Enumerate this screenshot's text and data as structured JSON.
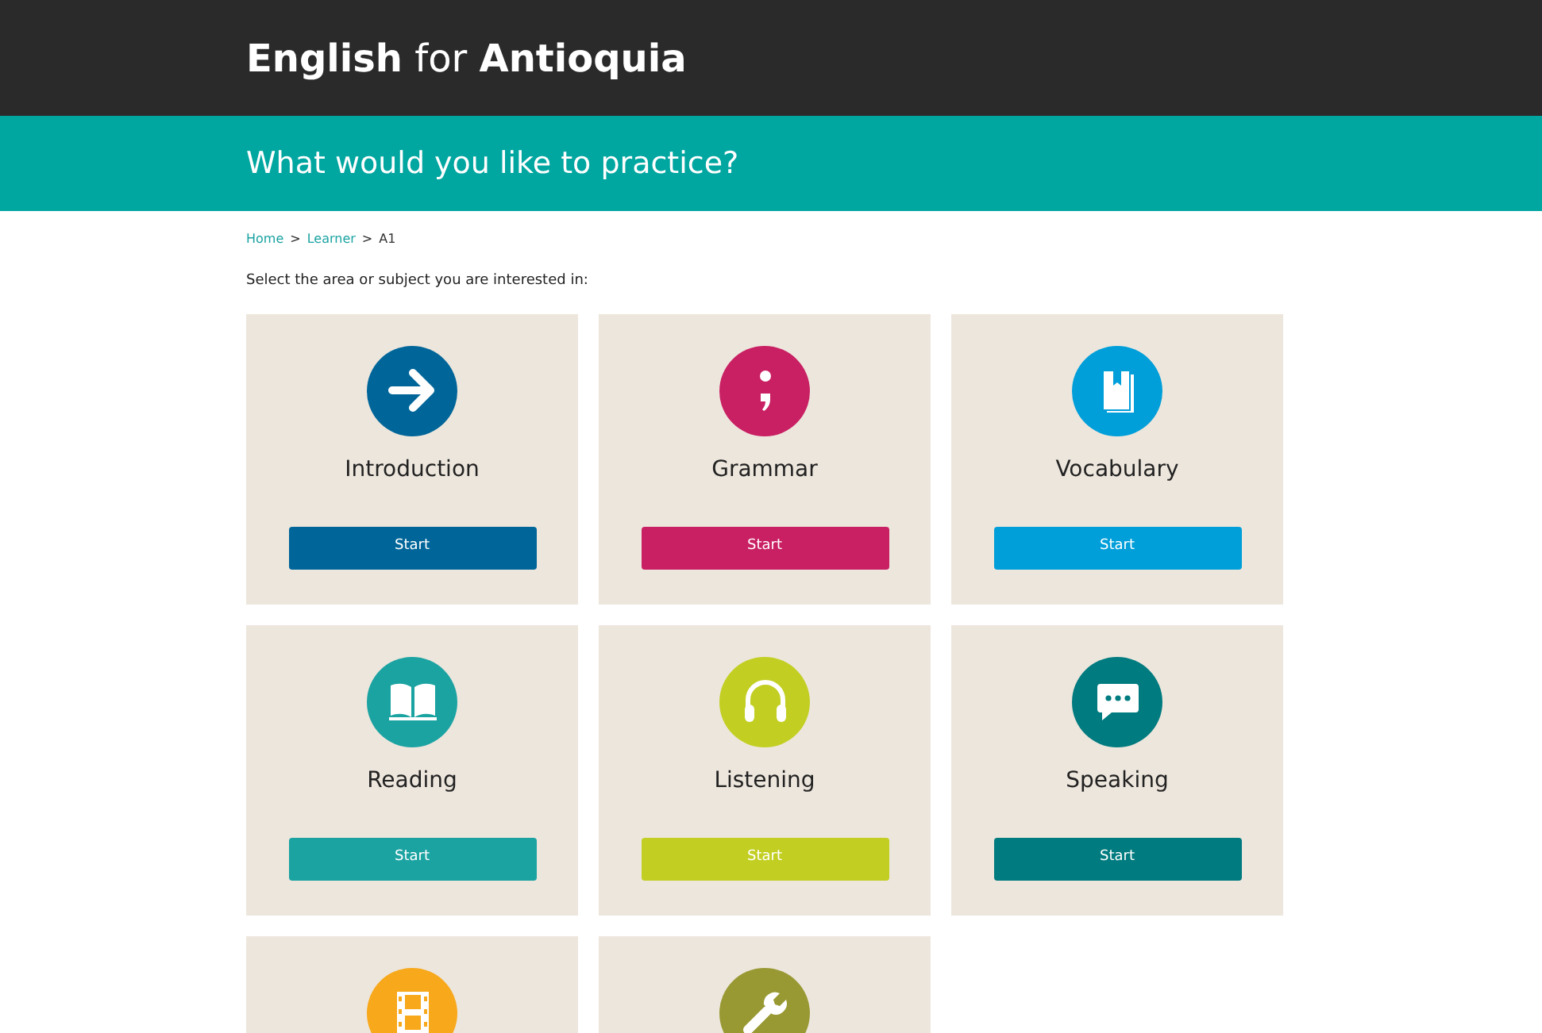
{
  "header": {
    "title": "**English** for **Antioquia**"
  },
  "banner": {
    "heading": "What would you like to practice?"
  },
  "breadcrumb": [
    {
      "text": "Home",
      "kind": "link"
    },
    {
      "text": ">",
      "kind": "separator"
    },
    {
      "text": "Learner",
      "kind": "link"
    },
    {
      "text": ">",
      "kind": "separator"
    },
    {
      "text": "A1",
      "kind": "current"
    }
  ],
  "instruction": "Select the area or subject you are interested in:",
  "cards": [
    {
      "title": "Introduction",
      "button": "Start",
      "color": "#006699"
    },
    {
      "title": "Grammar",
      "button": "Start",
      "color": "#c91f63"
    },
    {
      "title": "Vocabulary",
      "button": "Start",
      "color": "#009fda"
    },
    {
      "title": "Reading",
      "button": "Start",
      "color": "#1ba3a2"
    },
    {
      "title": "Listening",
      "button": "Start",
      "color": "#c2cf22"
    },
    {
      "title": "Speaking",
      "button": "Start",
      "color": "#007b7f"
    },
    {
      "color": "#f7a81b"
    },
    {
      "color": "#999933"
    }
  ]
}
